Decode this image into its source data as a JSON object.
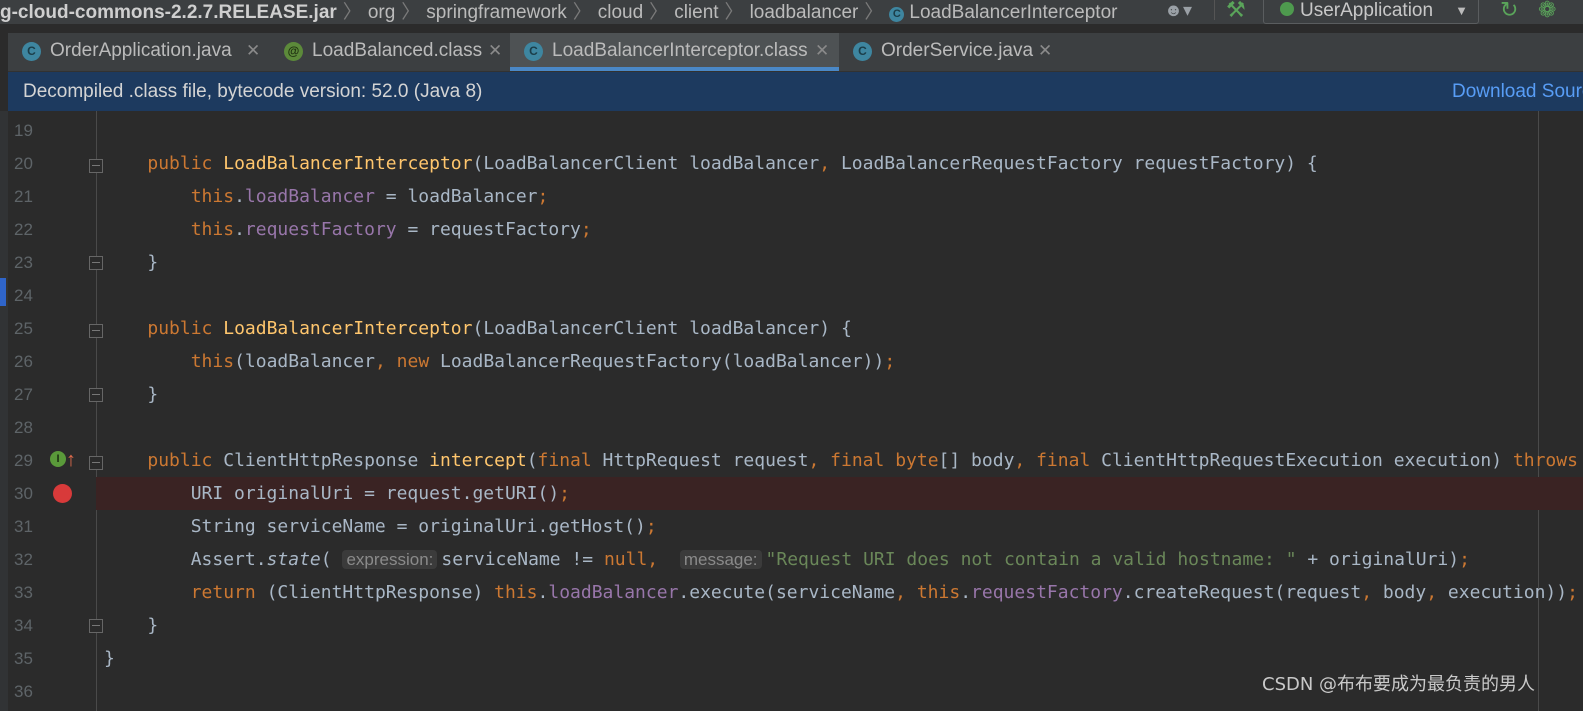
{
  "breadcrumb": {
    "jar": "g-cloud-commons-2.2.7.RELEASE.jar",
    "parts": [
      "org",
      "springframework",
      "cloud",
      "client",
      "loadbalancer"
    ],
    "current": "LoadBalancerInterceptor"
  },
  "toolbar": {
    "run_config": "UserApplication"
  },
  "tabs": [
    {
      "label": "OrderApplication.java",
      "icon": "app"
    },
    {
      "label": "LoadBalanced.class",
      "icon": "annotation"
    },
    {
      "label": "LoadBalancerInterceptor.class",
      "icon": "class",
      "active": true
    },
    {
      "label": "OrderService.java",
      "icon": "class"
    }
  ],
  "banner": {
    "text": "Decompiled .class file, bytecode version: 52.0 (Java 8)",
    "link": "Download Sources"
  },
  "editor": {
    "line_numbers": [
      "19",
      "20",
      "21",
      "22",
      "23",
      "24",
      "25",
      "26",
      "27",
      "28",
      "29",
      "30",
      "31",
      "32",
      "33",
      "34",
      "35",
      "36"
    ],
    "hints": {
      "expression": "expression:",
      "message": "message:"
    },
    "breakpoint_line": "30"
  },
  "colors": {
    "keyword": "#cc7832",
    "method": "#ffc66d",
    "field": "#9876aa",
    "string": "#6a8759",
    "text": "#a9b7c6",
    "breakpoint": "#d83a3a",
    "tab_accent": "#4a88c7",
    "banner_bg": "#1d3a5f"
  },
  "watermark": "CSDN @布布要成为最负责的男人"
}
